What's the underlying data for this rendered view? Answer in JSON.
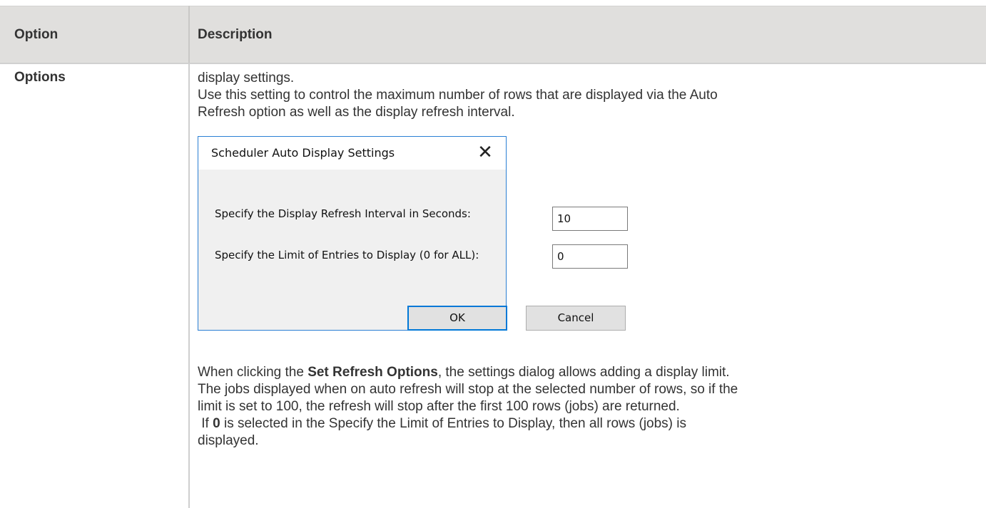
{
  "table": {
    "headers": [
      "Option",
      "Description"
    ]
  },
  "row": {
    "label": "Options",
    "para1_line1": "display settings.",
    "para1_line2": "Use this setting to control the maximum number of rows that are displayed via the Auto",
    "para1_line3": "Refresh option as well as the display refresh interval.",
    "para2_pre": "When clicking the ",
    "para2_bold": "Set Refresh Options",
    "para2_post": ", the settings dialog allows adding a display limit.",
    "para2_line2": "The jobs displayed when on auto refresh will stop at the selected number of rows, so if the",
    "para2_line3": "limit is set to 100, the refresh will stop after the first 100 rows (jobs) are returned.",
    "para3_pre": " If ",
    "para3_bold": "0",
    "para3_post": " is selected in the Specify the Limit of Entries to Display, then all rows (jobs) is",
    "para3_line2": "displayed."
  },
  "dialog": {
    "title": "Scheduler Auto Display Settings",
    "close_glyph": "✕",
    "refresh_label": "Specify the Display Refresh Interval in Seconds:",
    "refresh_value": "10",
    "limit_label": "Specify the Limit of Entries to Display (0 for ALL):",
    "limit_value": "0",
    "ok_label": "OK",
    "cancel_label": "Cancel"
  }
}
